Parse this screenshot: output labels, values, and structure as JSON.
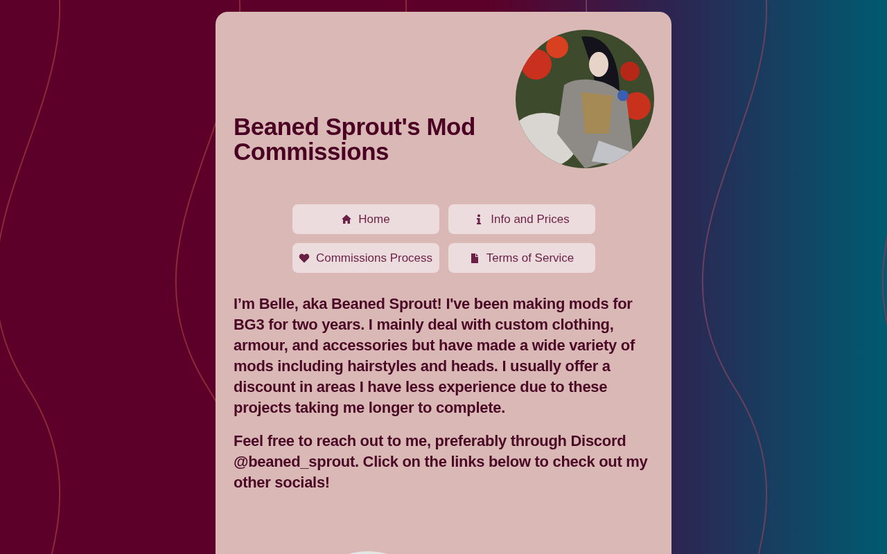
{
  "header": {
    "title": "Beaned Sprout's Mod Commissions"
  },
  "nav": [
    {
      "label": "Home",
      "kind": "home"
    },
    {
      "label": "Info and Prices",
      "kind": "info"
    },
    {
      "label": "Commissions Process",
      "kind": "heart"
    },
    {
      "label": "Terms of Service",
      "kind": "file"
    }
  ],
  "paragraphs": [
    "I’m Belle, aka Beaned Sprout! I've been making mods for BG3 for two years. I mainly deal with custom clothing, armour, and accessories but have made a wide variety of mods including hairstyles and heads. I usually offer a discount in areas I have less experience due to these projects taking me longer to complete.",
    "Feel free to reach out to me, preferably through Discord @beaned_sprout. Click on the links below to check out my other socials!"
  ]
}
